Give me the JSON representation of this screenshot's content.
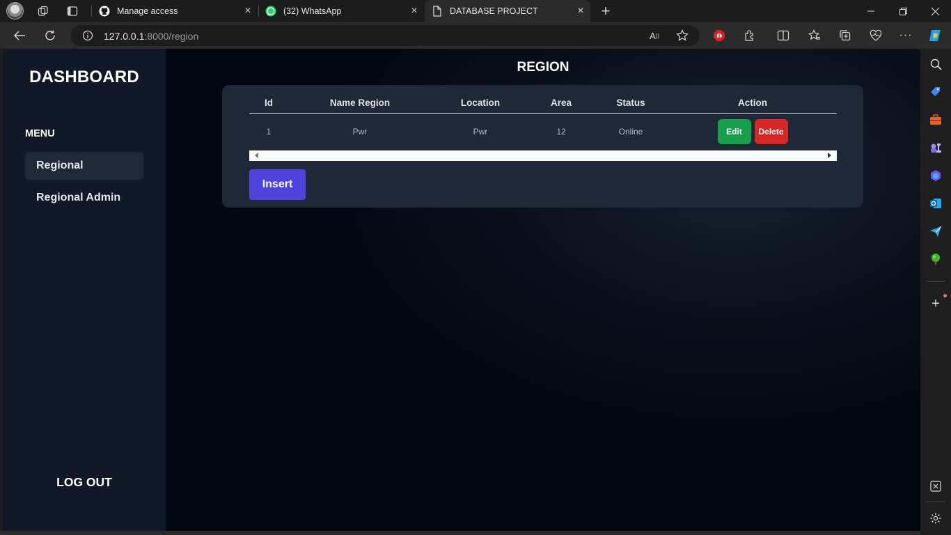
{
  "browser": {
    "tabs": [
      {
        "title": "Manage access",
        "favicon": "github-icon"
      },
      {
        "title": "(32) WhatsApp",
        "favicon": "whatsapp-icon"
      },
      {
        "title": "DATABASE PROJECT",
        "favicon": "page-icon",
        "active": true
      }
    ],
    "url_host": "127.0.0.1",
    "url_path": ":8000/region"
  },
  "sidebar": {
    "brand": "DASHBOARD",
    "menu_heading": "MENU",
    "items": [
      {
        "label": "Regional",
        "active": true
      },
      {
        "label": "Regional Admin",
        "active": false
      }
    ],
    "logout": "LOG OUT"
  },
  "main": {
    "title": "REGION",
    "table": {
      "columns": [
        "Id",
        "Name Region",
        "Location",
        "Area",
        "Status",
        "Action"
      ],
      "rows": [
        {
          "id": "1",
          "name": "Pwr",
          "location": "Pwr",
          "area": "12",
          "status": "Online",
          "edit": "Edit",
          "delete": "Delete"
        }
      ]
    },
    "insert_label": "Insert"
  },
  "colors": {
    "sidebar_bg": "#111827",
    "card_bg": "#1f2937",
    "edit": "#16a34a",
    "delete": "#dc2626",
    "insert": "#4f46e5"
  }
}
